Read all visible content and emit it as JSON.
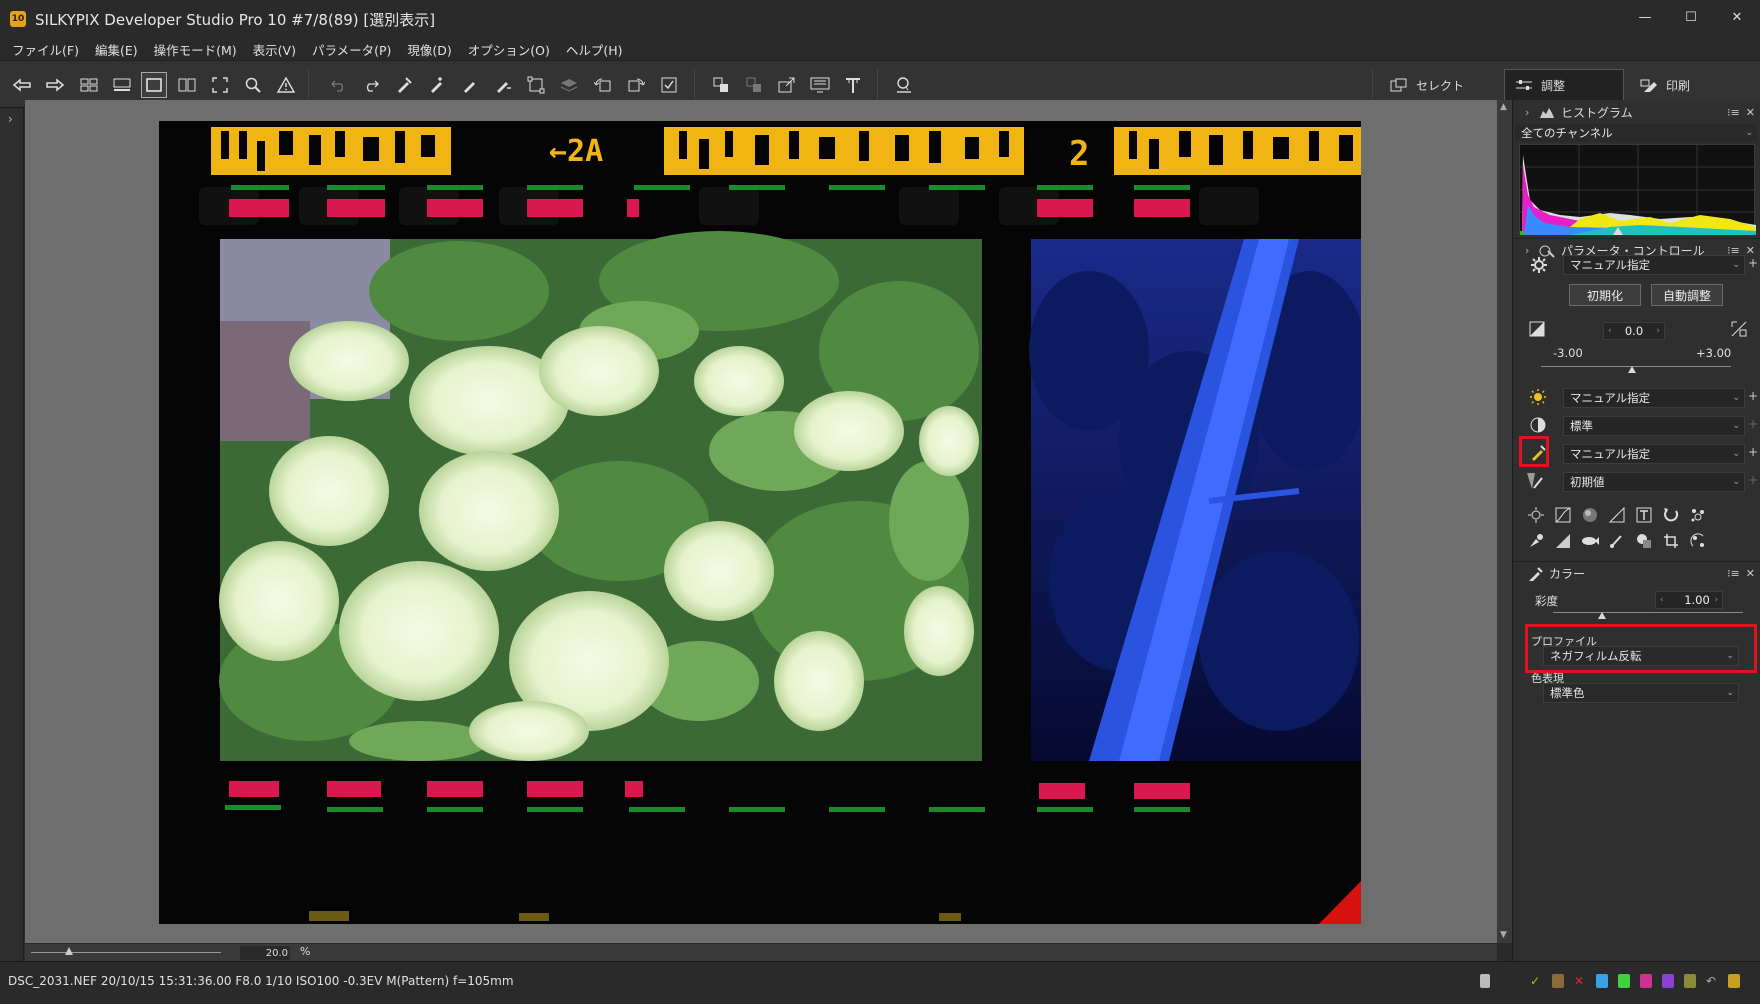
{
  "window": {
    "badge": "10",
    "title": "SILKYPIX Developer Studio Pro 10    #7/8(89) [選別表示]",
    "minimize": "—",
    "maximize": "☐",
    "close": "✕"
  },
  "menu": {
    "items": [
      "ファイル(F)",
      "編集(E)",
      "操作モード(M)",
      "表示(V)",
      "パラメータ(P)",
      "現像(D)",
      "オプション(O)",
      "ヘルプ(H)"
    ]
  },
  "modes": {
    "select_label": "セレクト",
    "adjust_label": "調整",
    "print_label": "印刷"
  },
  "viewer": {
    "zoom_value": "20.0",
    "zoom_unit": "%"
  },
  "status": {
    "info": "DSC_2031.NEF 20/10/15 15:31:36.00 F8.0 1/10 ISO100 -0.3EV M(Pattern) f=105mm"
  },
  "panel": {
    "histogram": {
      "title": "ヒストグラム",
      "channel": "全てのチャンネル"
    },
    "param_control": {
      "title": "パラメータ・コントロール",
      "taste": "マニュアル指定",
      "init_button": "初期化",
      "auto_button": "自動調整",
      "exposure_value": "0.0",
      "exposure_min": "-3.00",
      "exposure_max": "+3.00",
      "wb": "マニュアル指定",
      "tone": "標準",
      "color_preset": "マニュアル指定",
      "sharpness": "初期値"
    },
    "color": {
      "title": "カラー",
      "saturation_label": "彩度",
      "saturation_value": "1.00",
      "profile_label": "プロファイル",
      "profile_value": "ネガフィルム反転",
      "rendering_label": "色表現",
      "rendering_value": "標準色"
    }
  },
  "photo": {
    "edge_top_right": "←2A",
    "edge_frame_number": "2"
  },
  "colors": {
    "highlight": "#e0141e",
    "edge_yellow": "#f0b512",
    "edge_red": "#d8184e",
    "edge_green": "#1a8a2a"
  }
}
